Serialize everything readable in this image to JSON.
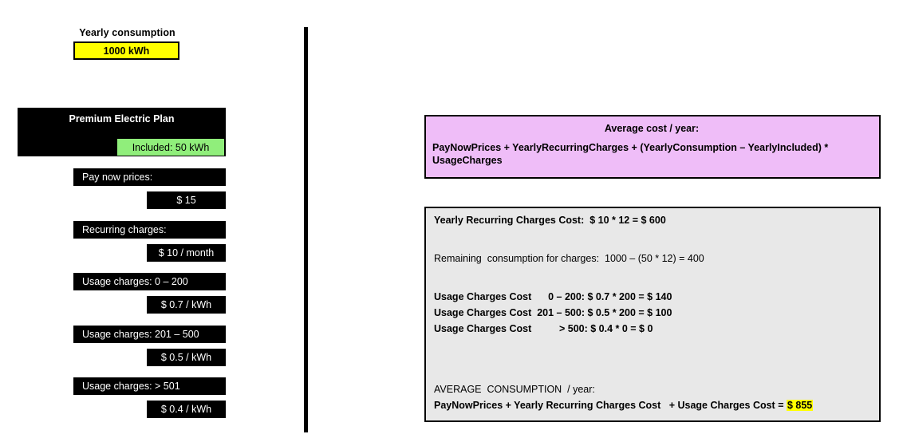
{
  "left_panel": {
    "consumption_label": "Yearly consumption",
    "consumption_value": "1000 kWh",
    "plan_title": "Premium Electric Plan",
    "included_chip": "Included: 50 kWh",
    "attributes": [
      {
        "label": "Pay now prices:",
        "value": "$ 15"
      },
      {
        "label": "Recurring charges:",
        "value": "$ 10 / month"
      },
      {
        "label": "Usage charges: 0 – 200",
        "value": "$ 0.7 / kWh"
      },
      {
        "label": "Usage charges: 201 – 500",
        "value": "$ 0.5 / kWh"
      },
      {
        "label": "Usage charges: > 501",
        "value": "$ 0.4 / kWh"
      }
    ]
  },
  "right_panel": {
    "formula": {
      "heading": "Average cost  / year:",
      "body": "PayNowPrices + YearlyRecurringCharges  + (YearlyConsumption  – YearlyIncluded) * UsageCharges"
    },
    "calculation": {
      "recurring_line": "Yearly Recurring Charges Cost:  $ 10 * 12 = $ 600",
      "remaining_line": "Remaining  consumption for charges:  1000 – (50 * 12) = 400",
      "usage_lines": [
        "Usage Charges Cost      0 – 200: $ 0.7 * 200 = $ 140",
        "Usage Charges Cost  201 – 500: $ 0.5 * 200 = $ 100",
        "Usage Charges Cost          > 500: $ 0.4 * 0 = $ 0"
      ],
      "average_heading": "AVERAGE  CONSUMPTION  / year:",
      "average_formula_prefix": "PayNowPrices + Yearly Recurring Charges Cost   + Usage Charges Cost = ",
      "average_result": "$ 855"
    }
  },
  "colors": {
    "highlight_yellow": "#ffff00",
    "included_green": "#90ee7b",
    "formula_pink": "#efbdf8",
    "calc_gray": "#e8e8e8",
    "bar_black": "#000000"
  }
}
